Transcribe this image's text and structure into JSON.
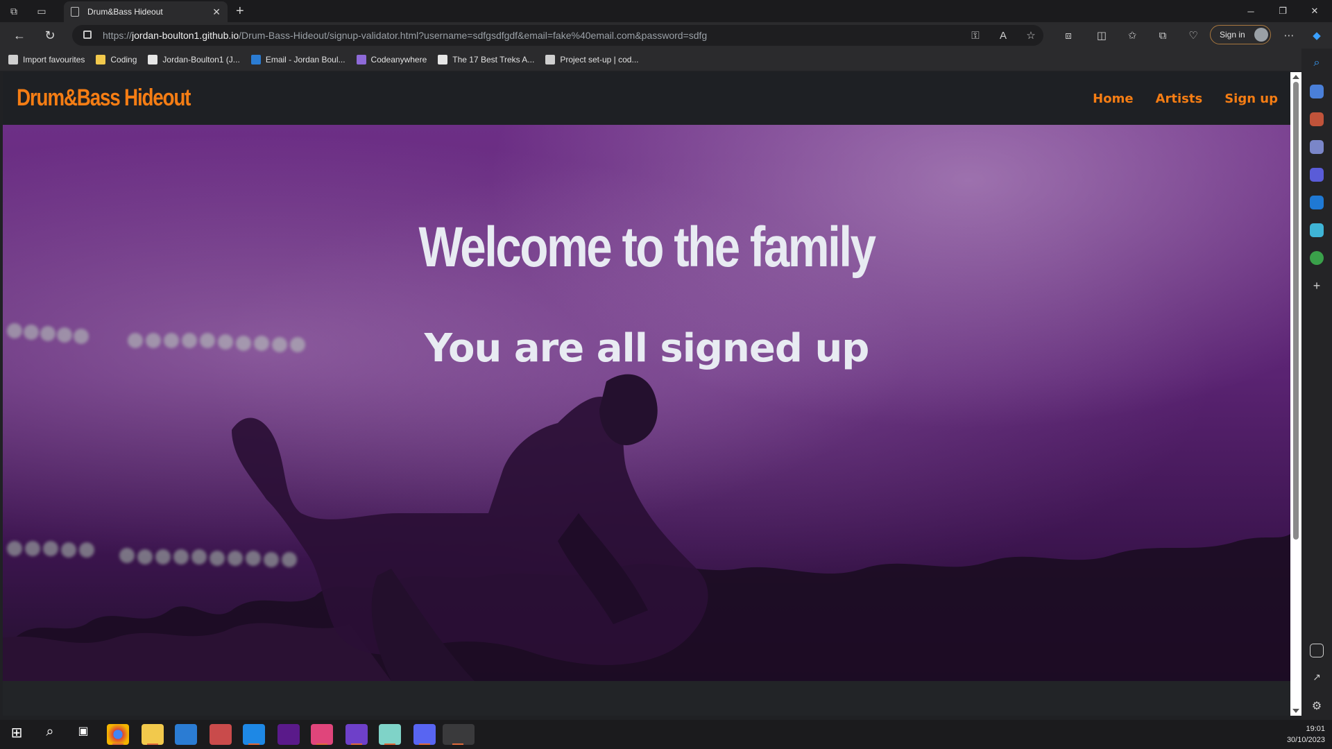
{
  "browser": {
    "tab_title": "Drum&Bass Hideout",
    "url_scheme": "https://",
    "url_host": "jordan-boulton1.github.io",
    "url_path": "/Drum-Bass-Hideout/signup-validator.html?username=sdfgsdfgdf&email=fake%40email.com&password=sdfg",
    "sign_in_label": "Sign in",
    "favourites": [
      {
        "label": "Import favourites",
        "icon": "import-icon",
        "color": "#cfcfcf"
      },
      {
        "label": "Coding",
        "icon": "folder-icon",
        "color": "#f2c94c"
      },
      {
        "label": "Jordan-Boulton1 (J...",
        "icon": "github-icon",
        "color": "#e6e6e6"
      },
      {
        "label": "Email - Jordan Boul...",
        "icon": "outlook-icon",
        "color": "#2b7cd3"
      },
      {
        "label": "Codeanywhere",
        "icon": "codeanywhere-icon",
        "color": "#8e6ad8"
      },
      {
        "label": "The 17 Best Treks A...",
        "icon": "page-icon",
        "color": "#e6e6e6"
      },
      {
        "label": "Project set-up | cod...",
        "icon": "document-icon",
        "color": "#cfcfcf"
      }
    ]
  },
  "site": {
    "logo": "Drum&Bass Hideout",
    "nav": [
      {
        "label": "Home"
      },
      {
        "label": "Artists"
      },
      {
        "label": "Sign up"
      }
    ],
    "hero_title": "Welcome to the family",
    "hero_subtitle": "You are all signed up",
    "accent_color": "#f57d14"
  },
  "taskbar": {
    "time": "19:01",
    "date": "30/10/2023"
  }
}
